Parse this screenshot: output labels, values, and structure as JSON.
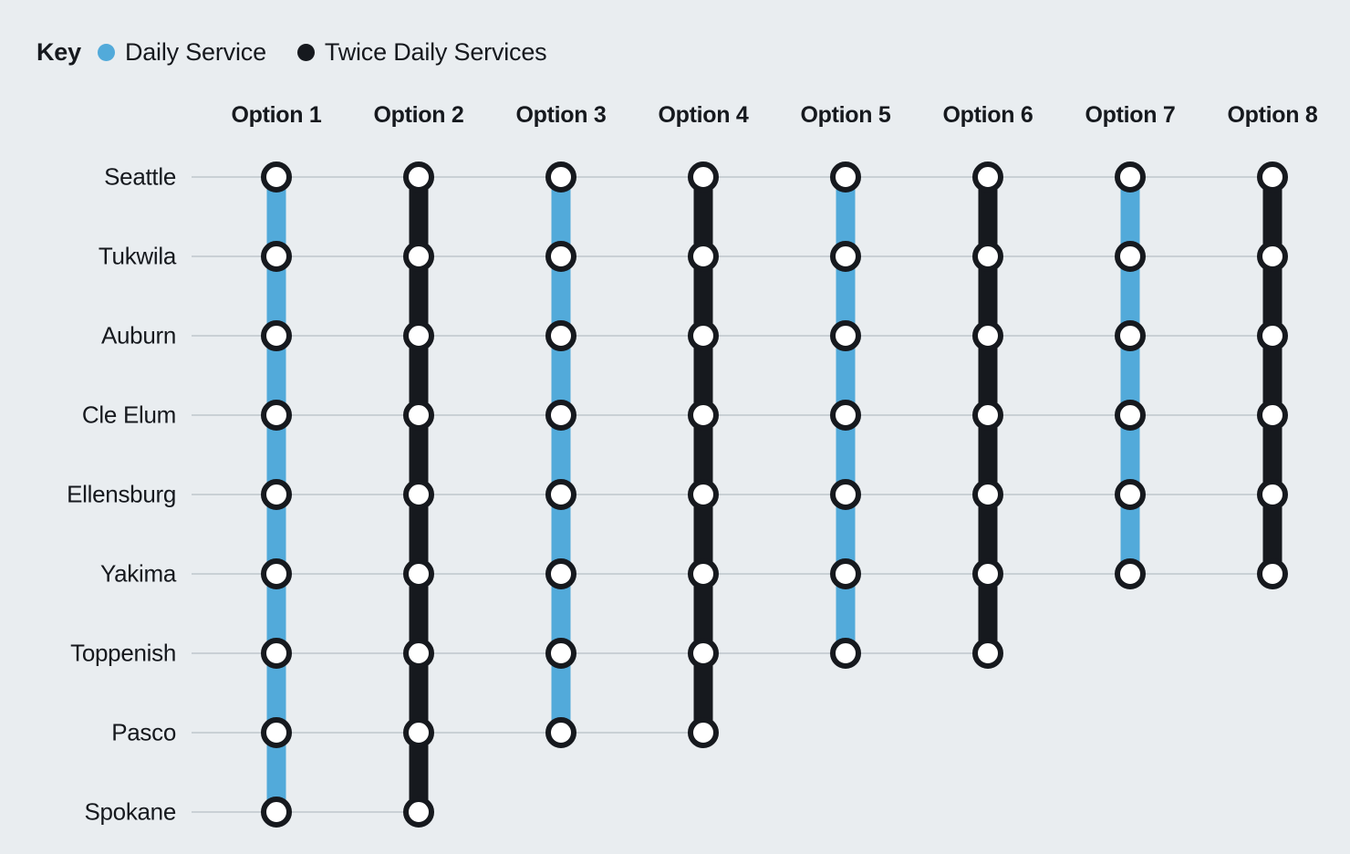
{
  "legend": {
    "title": "Key",
    "items": [
      {
        "label": "Daily Service",
        "color": "#52aada",
        "icon": "circle-icon"
      },
      {
        "label": "Twice Daily Services",
        "color": "#16191e",
        "icon": "circle-icon"
      }
    ]
  },
  "colors": {
    "background": "#e9edf0",
    "daily_service": "#52aada",
    "twice_daily_service": "#16191e",
    "gridline": "#a9b2ba",
    "node_fill": "#ffffff",
    "node_stroke": "#16191e",
    "text": "#16191e"
  },
  "chart_data": {
    "type": "table",
    "title": "",
    "subtitle": "",
    "xlabel": "",
    "ylabel": "",
    "grid": true,
    "legend_position": "top-left",
    "categories": [
      "Seattle",
      "Tukwila",
      "Auburn",
      "Cle Elum",
      "Ellensburg",
      "Yakima",
      "Toppenish",
      "Pasco",
      "Spokane"
    ],
    "column_headers": [
      "Option 1",
      "Option 2",
      "Option 3",
      "Option 4",
      "Option 5",
      "Option 6",
      "Option 7",
      "Option 8"
    ],
    "series": [
      {
        "name": "Option 1",
        "service": "Daily Service",
        "color": "#52aada",
        "terminus": "Spokane",
        "stop_count": 9,
        "stops": [
          "Seattle",
          "Tukwila",
          "Auburn",
          "Cle Elum",
          "Ellensburg",
          "Yakima",
          "Toppenish",
          "Pasco",
          "Spokane"
        ]
      },
      {
        "name": "Option 2",
        "service": "Twice Daily Services",
        "color": "#16191e",
        "terminus": "Spokane",
        "stop_count": 9,
        "stops": [
          "Seattle",
          "Tukwila",
          "Auburn",
          "Cle Elum",
          "Ellensburg",
          "Yakima",
          "Toppenish",
          "Pasco",
          "Spokane"
        ]
      },
      {
        "name": "Option 3",
        "service": "Daily Service",
        "color": "#52aada",
        "terminus": "Pasco",
        "stop_count": 8,
        "stops": [
          "Seattle",
          "Tukwila",
          "Auburn",
          "Cle Elum",
          "Ellensburg",
          "Yakima",
          "Toppenish",
          "Pasco"
        ]
      },
      {
        "name": "Option 4",
        "service": "Twice Daily Services",
        "color": "#16191e",
        "terminus": "Pasco",
        "stop_count": 8,
        "stops": [
          "Seattle",
          "Tukwila",
          "Auburn",
          "Cle Elum",
          "Ellensburg",
          "Yakima",
          "Toppenish",
          "Pasco"
        ]
      },
      {
        "name": "Option 5",
        "service": "Daily Service",
        "color": "#52aada",
        "terminus": "Toppenish",
        "stop_count": 7,
        "stops": [
          "Seattle",
          "Tukwila",
          "Auburn",
          "Cle Elum",
          "Ellensburg",
          "Yakima",
          "Toppenish"
        ]
      },
      {
        "name": "Option 6",
        "service": "Twice Daily Services",
        "color": "#16191e",
        "terminus": "Toppenish",
        "stop_count": 7,
        "stops": [
          "Seattle",
          "Tukwila",
          "Auburn",
          "Cle Elum",
          "Ellensburg",
          "Yakima",
          "Toppenish"
        ]
      },
      {
        "name": "Option 7",
        "service": "Daily Service",
        "color": "#52aada",
        "terminus": "Yakima",
        "stop_count": 6,
        "stops": [
          "Seattle",
          "Tukwila",
          "Auburn",
          "Cle Elum",
          "Ellensburg",
          "Yakima"
        ]
      },
      {
        "name": "Option 8",
        "service": "Twice Daily Services",
        "color": "#16191e",
        "terminus": "Yakima",
        "stop_count": 6,
        "stops": [
          "Seattle",
          "Tukwila",
          "Auburn",
          "Cle Elum",
          "Ellensburg",
          "Yakima"
        ]
      }
    ]
  },
  "geometry": {
    "first_row_y": 194,
    "row_spacing": 87,
    "first_col_x": 303,
    "col_spacing": 156,
    "grid_left_x": 210
  }
}
